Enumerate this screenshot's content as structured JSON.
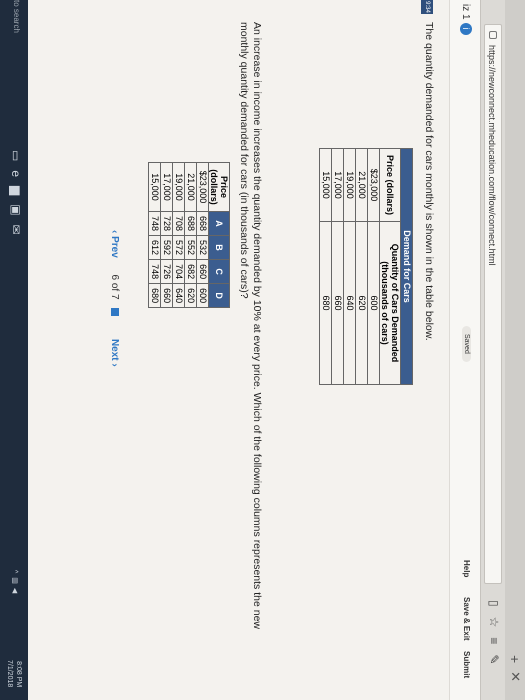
{
  "browser": {
    "url": "https://newconnect.mheducation.com/flow/connect.html"
  },
  "app": {
    "quiz_label": "iz 1",
    "info_glyph": "i",
    "saved_label": "Saved",
    "help_label": "Help",
    "save_exit_label": "Save & Exit",
    "submit_label": "Submit",
    "side_tag": "9:34"
  },
  "question": {
    "intro": "The quantity demanded for cars monthly is shown in the table below.",
    "table1": {
      "caption": "Demand for Cars",
      "headers": [
        "Price (dollars)",
        "Quantity of Cars Demanded (thousands of cars)"
      ],
      "rows": [
        [
          "$23,000",
          "600"
        ],
        [
          "21,000",
          "620"
        ],
        [
          "19,000",
          "640"
        ],
        [
          "17,000",
          "660"
        ],
        [
          "15,000",
          "680"
        ]
      ]
    },
    "prompt": "An increase in income increases the quantity demanded by 10% at every price. Which of the following columns represents the new monthly quantity demanded for cars (in thousands of cars)?",
    "table2": {
      "headers": [
        "Price (dollars)",
        "A",
        "B",
        "C",
        "D"
      ],
      "rows": [
        [
          "$23,000",
          "668",
          "532",
          "660",
          "600"
        ],
        [
          "21,000",
          "688",
          "552",
          "682",
          "620"
        ],
        [
          "19,000",
          "708",
          "572",
          "704",
          "640"
        ],
        [
          "17,000",
          "728",
          "592",
          "726",
          "660"
        ],
        [
          "15,000",
          "748",
          "612",
          "748",
          "680"
        ]
      ]
    }
  },
  "pager": {
    "prev_label": "Prev",
    "page_current": "6",
    "page_of": "of",
    "page_total": "7",
    "next_label": "Next"
  },
  "taskbar": {
    "search_text": "to search",
    "time": "8:08 PM",
    "date": "7/1/2018"
  },
  "colors": {
    "table_header": "#3b5d8f",
    "link": "#2f78c4"
  }
}
